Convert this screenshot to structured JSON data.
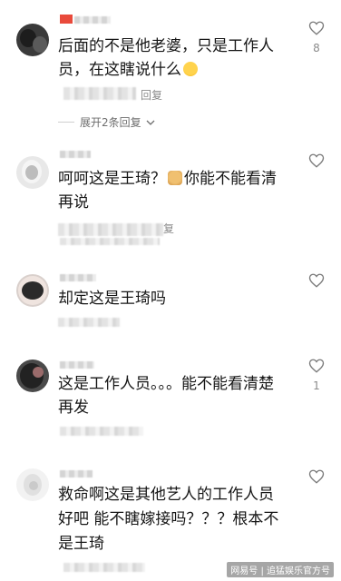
{
  "comments": [
    {
      "text": "后面的不是他老婆，只是工作人员，在这瞎说什么",
      "reply_label": "回复",
      "likes": "8",
      "expand_label": "展开2条回复"
    },
    {
      "text_part1": "呵呵这是王琦？",
      "text_part2": "你能不能看清再说",
      "reply_label": "复"
    },
    {
      "text": "却定这是王琦吗"
    },
    {
      "text": "这是工作人员。。。能不能看清楚再发",
      "likes": "1"
    },
    {
      "text": "救命啊这是其他艺人的工作人员好吧 能不瞎嫁接吗？？？根本不是王琦"
    }
  ],
  "watermark": "网易号 | 追猛娱乐官方号",
  "colors": {
    "accent": "#e94a3b",
    "heart": "#7a7a7a"
  }
}
